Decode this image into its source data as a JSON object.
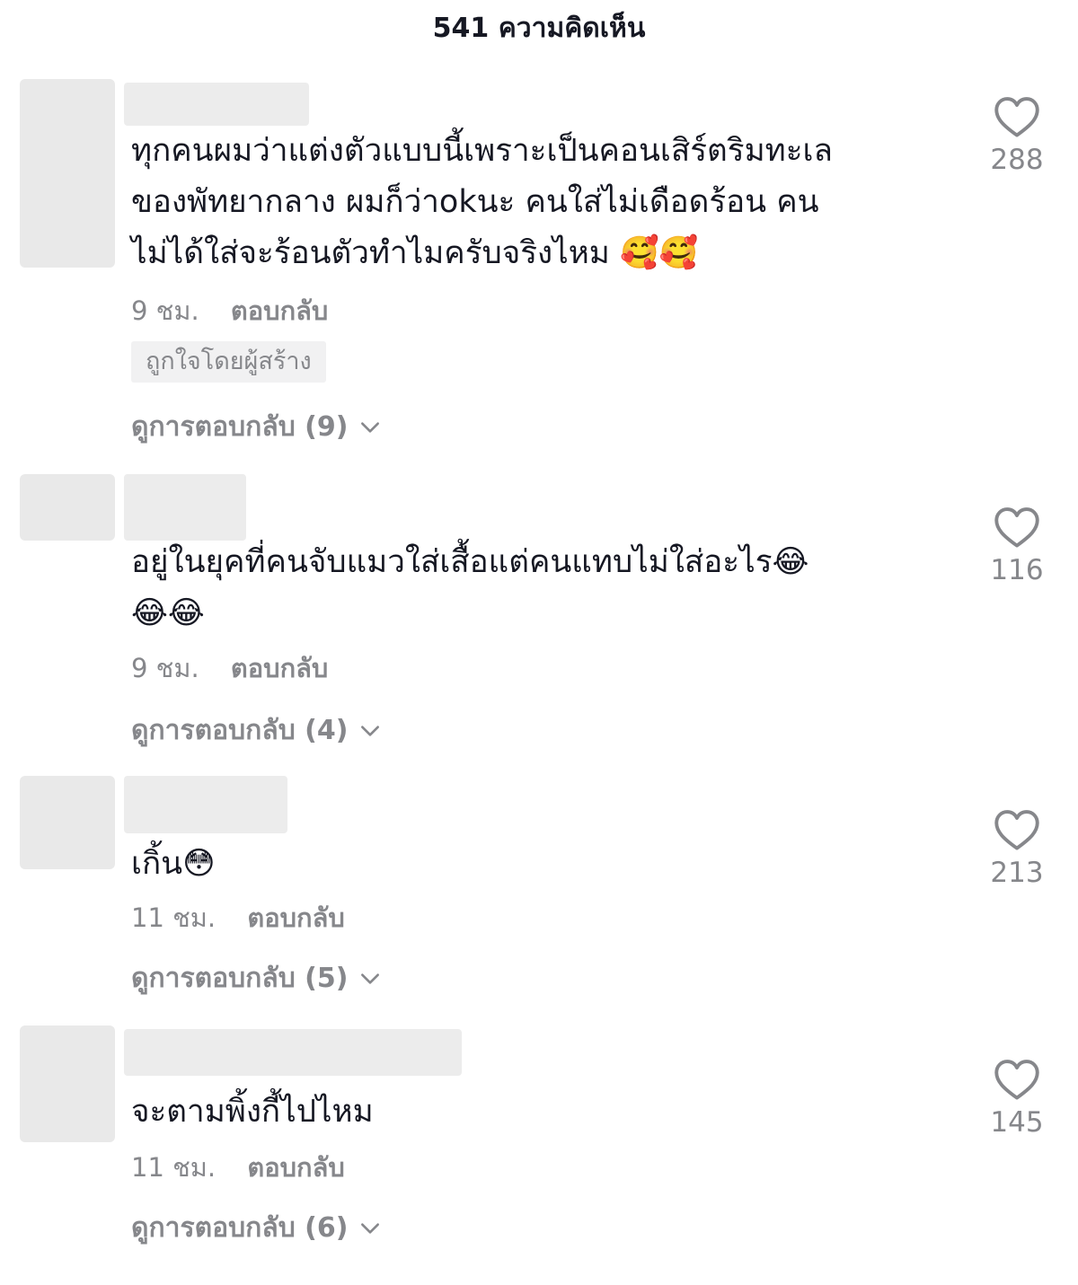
{
  "header": {
    "title": "541 ความคิดเห็น"
  },
  "comments": [
    {
      "text": "ทุกคนผมว่าแต่งตัวแบบนี้เพราะเป็นคอนเสิร์ตริมทะเล\nของพัทยากลาง ผมก็ว่าokนะ คนใส่ไม่เดือดร้อน คน\nไม่ได้ใส่จะร้อนตัวทำไมครับจริงไหม 🥰🥰",
      "time": "9 ชม.",
      "reply_label": "ตอบกลับ",
      "badge": "ถูกใจโดยผู้สร้าง",
      "view_replies": "ดูการตอบกลับ (9)",
      "likes": "288"
    },
    {
      "text": "อยู่ในยุคที่คนจับแมวใส่เสื้อแต่คนแทบไม่ใส่อะไร😂\n😂😂",
      "time": "9 ชม.",
      "reply_label": "ตอบกลับ",
      "view_replies": "ดูการตอบกลับ (4)",
      "likes": "116"
    },
    {
      "text": "เกิ้น😳",
      "time": "11 ชม.",
      "reply_label": "ตอบกลับ",
      "view_replies": "ดูการตอบกลับ (5)",
      "likes": "213"
    },
    {
      "text": "จะตามพิ้งกี้ไปไหม",
      "time": "11 ชม.",
      "reply_label": "ตอบกลับ",
      "view_replies": "ดูการตอบกลับ (6)",
      "likes": "145"
    }
  ],
  "icons": {
    "like": "heart-outline-icon",
    "expand": "chevron-down-icon"
  },
  "colors": {
    "text": "#161823",
    "muted": "#86878b",
    "badge_bg": "#f1f1f2"
  }
}
